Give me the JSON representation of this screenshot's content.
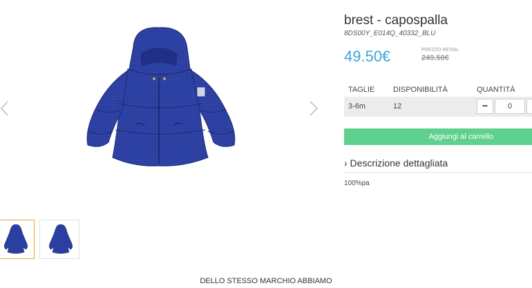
{
  "product": {
    "title": "brest - capospalla",
    "sku": "8DS00Y_E014Q_40332_BLU",
    "price": "49.50€",
    "retail_label": "PREZZO RETAIL",
    "retail_price": "249.50€"
  },
  "gallery": {
    "prev_icon": "chevron-left-icon",
    "next_icon": "chevron-right-icon",
    "jacket_color": "#2b3fa0",
    "active_thumb_border": "#f0a23c"
  },
  "table": {
    "headers": [
      "TAGLIE",
      "DISPONIBILITÀ",
      "QUANTITÀ"
    ],
    "rows": [
      {
        "size": "3-6m",
        "availability": "12",
        "quantity": "0",
        "minus_label": "−"
      }
    ]
  },
  "cart": {
    "button_label": "Aggiungi al carrello",
    "color": "#5fd18e"
  },
  "description": {
    "toggle_label": "› Descrizione dettagliata",
    "text": "100%pa"
  },
  "brand_section": {
    "heading": "DELLO STESSO MARCHIO ABBIAMO"
  },
  "colors": {
    "price": "#3aa6d8"
  }
}
